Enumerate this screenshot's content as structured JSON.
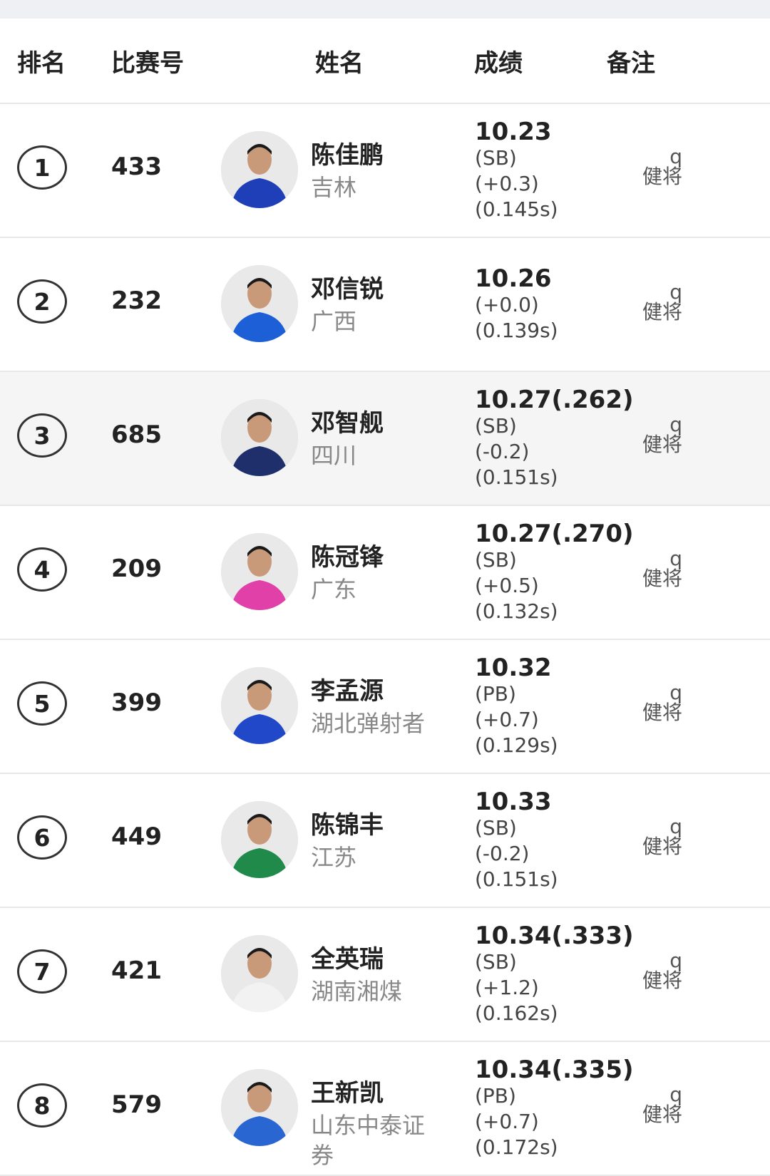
{
  "header": {
    "rank": "排名",
    "bib": "比赛号",
    "name": "姓名",
    "score": "成绩",
    "note": "备注"
  },
  "rows": [
    {
      "rank": "1",
      "bib": "433",
      "name": "陈佳鹏",
      "team": "吉林",
      "time": "10.23",
      "details": [
        "(SB)",
        "(+0.3)",
        "(0.145s)"
      ],
      "q": "q",
      "note_team": "健将",
      "jersey": "#1f3fb8"
    },
    {
      "rank": "2",
      "bib": "232",
      "name": "邓信锐",
      "team": "广西",
      "time": "10.26",
      "details": [
        "(+0.0)",
        "(0.139s)"
      ],
      "q": "q",
      "note_team": "健将",
      "jersey": "#1d5fd6"
    },
    {
      "rank": "3",
      "bib": "685",
      "name": "邓智舰",
      "team": "四川",
      "time": "10.27(.262)",
      "details": [
        "(SB)",
        "(-0.2)",
        "(0.151s)"
      ],
      "q": "q",
      "note_team": "健将",
      "jersey": "#1e2f6b"
    },
    {
      "rank": "4",
      "bib": "209",
      "name": "陈冠锋",
      "team": "广东",
      "time": "10.27(.270)",
      "details": [
        "(SB)",
        "(+0.5)",
        "(0.132s)"
      ],
      "q": "q",
      "note_team": "健将",
      "jersey": "#e040a8"
    },
    {
      "rank": "5",
      "bib": "399",
      "name": "李孟源",
      "team": "湖北弹射者",
      "time": "10.32",
      "details": [
        "(PB)",
        "(+0.7)",
        "(0.129s)"
      ],
      "q": "q",
      "note_team": "健将",
      "jersey": "#2148c8"
    },
    {
      "rank": "6",
      "bib": "449",
      "name": "陈锦丰",
      "team": "江苏",
      "time": "10.33",
      "details": [
        "(SB)",
        "(-0.2)",
        "(0.151s)"
      ],
      "q": "q",
      "note_team": "健将",
      "jersey": "#1f8a4a"
    },
    {
      "rank": "7",
      "bib": "421",
      "name": "全英瑞",
      "team": "湖南湘煤",
      "time": "10.34(.333)",
      "details": [
        "(SB)",
        "(+1.2)",
        "(0.162s)"
      ],
      "q": "q",
      "note_team": "健将",
      "jersey": "#f2f2f2"
    },
    {
      "rank": "8",
      "bib": "579",
      "name": "王新凯",
      "team": "山东中泰证券",
      "time": "10.34(.335)",
      "details": [
        "(PB)",
        "(+0.7)",
        "(0.172s)"
      ],
      "q": "q",
      "note_team": "健将",
      "jersey": "#2a66d1"
    }
  ]
}
